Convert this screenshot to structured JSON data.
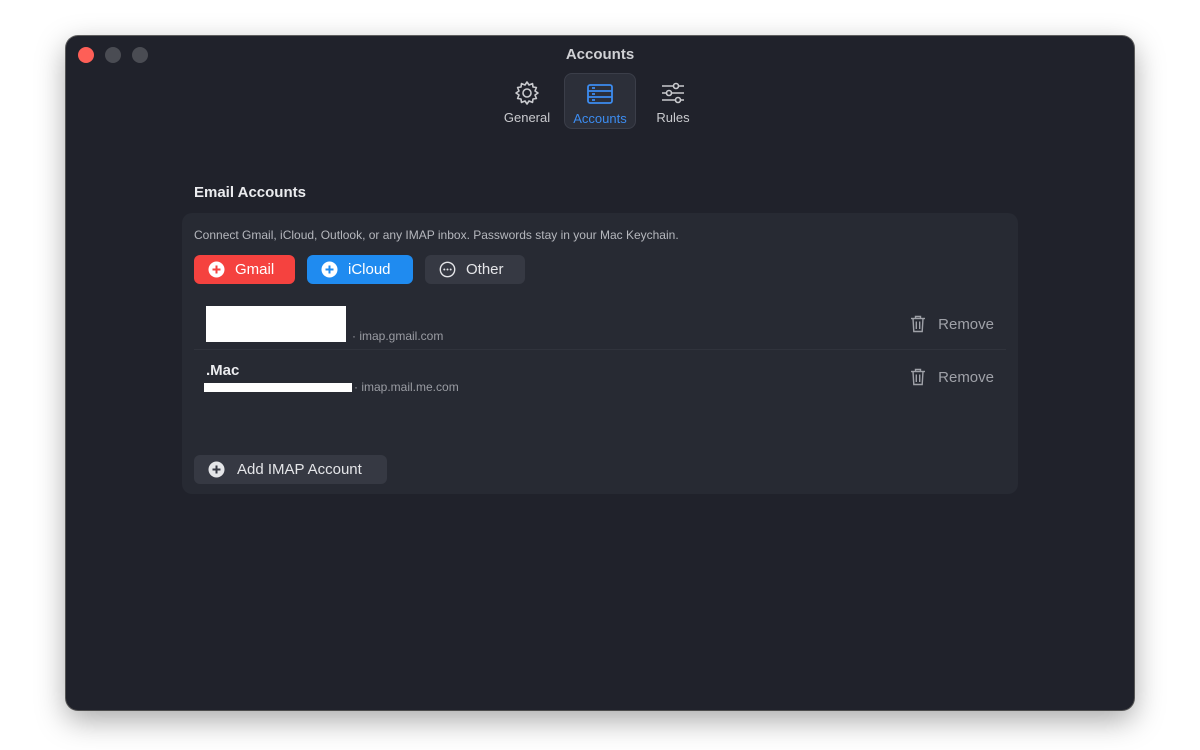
{
  "window": {
    "title": "Accounts"
  },
  "toolbar": {
    "items": [
      {
        "label": "General",
        "icon": "gear-icon",
        "active": false
      },
      {
        "label": "Accounts",
        "icon": "accounts-icon",
        "active": true
      },
      {
        "label": "Rules",
        "icon": "sliders-icon",
        "active": false
      }
    ]
  },
  "section": {
    "title": "Email Accounts",
    "description": "Connect Gmail, iCloud, Outlook, or any IMAP inbox. Passwords stay in your Mac Keychain."
  },
  "providers": {
    "gmail_label": "Gmail",
    "icloud_label": "iCloud",
    "other_label": "Other"
  },
  "accounts": [
    {
      "name": "",
      "host": "· imap.gmail.com",
      "remove_label": "Remove"
    },
    {
      "name": ".Mac",
      "host": "· imap.mail.me.com",
      "remove_label": "Remove"
    }
  ],
  "add_button": {
    "label": "Add IMAP Account"
  },
  "colors": {
    "window_bg": "#20222b",
    "accent": "#3c8cf0",
    "gmail": "#f5423f",
    "icloud": "#1f8bf0"
  }
}
